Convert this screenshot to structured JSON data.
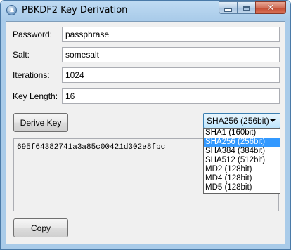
{
  "window": {
    "title": "PBKDF2 Key Derivation"
  },
  "form": {
    "password_label": "Password:",
    "password_value": "passphrase",
    "salt_label": "Salt:",
    "salt_value": "somesalt",
    "iterations_label": "Iterations:",
    "iterations_value": "1024",
    "keylength_label": "Key Length:",
    "keylength_value": "16"
  },
  "actions": {
    "derive_label": "Derive Key",
    "copy_label": "Copy"
  },
  "hash": {
    "selected": "SHA256 (256bit)",
    "options": [
      "SHA1 (160bit)",
      "SHA256 (256bit)",
      "SHA384 (384bit)",
      "SHA512 (512bit)",
      "MD2 (128bit)",
      "MD4 (128bit)",
      "MD5 (128bit)"
    ],
    "highlighted_index": 1
  },
  "output": {
    "value": "695f64382741a3a85c00421d302e8fbc"
  }
}
